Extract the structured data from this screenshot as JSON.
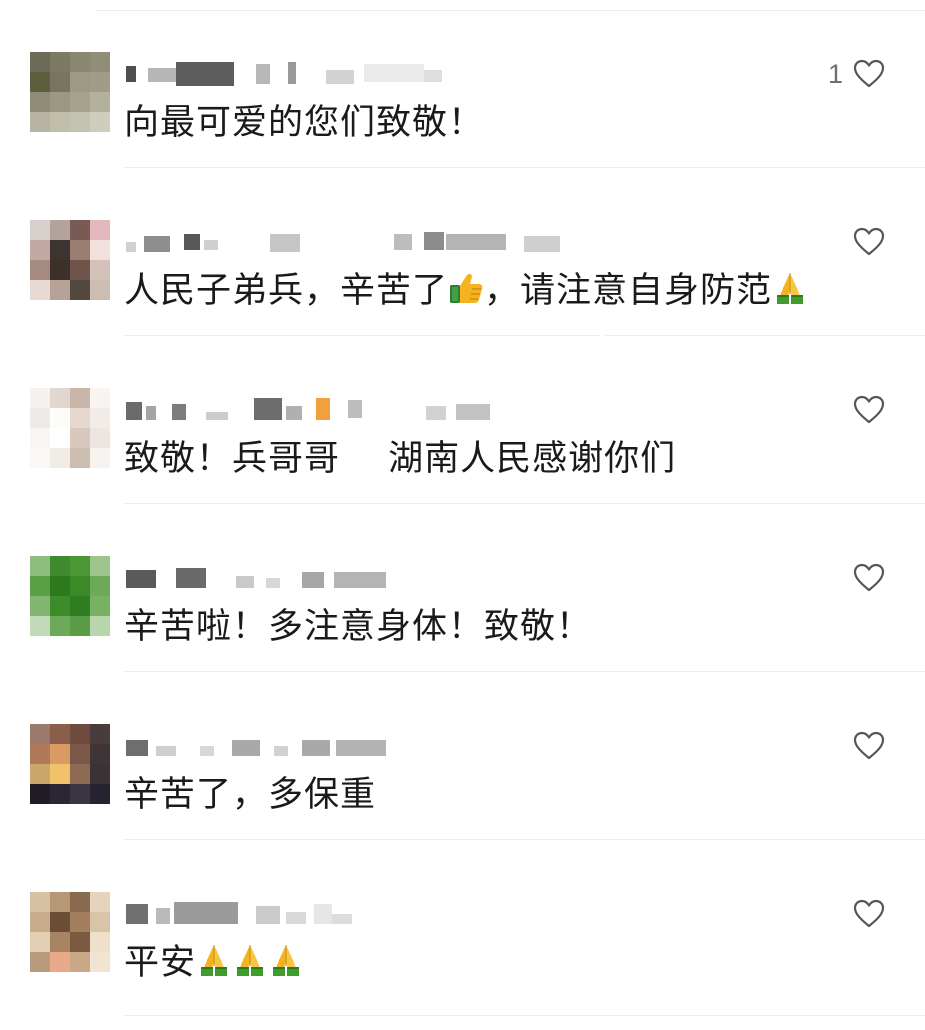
{
  "comments": [
    {
      "text_segments": [
        "向最可爱的您们致敬！"
      ],
      "likes": "1",
      "avatar_colors": [
        "#6d6a58",
        "#7c7a63",
        "#8a8770",
        "#908d78",
        "#5c5f3c",
        "#77755f",
        "#9c9985",
        "#a09c88",
        "#8f8c77",
        "#9b9882",
        "#a5a28d",
        "#b3b09d",
        "#b7b4a3",
        "#c1bea9",
        "#c4c2b0",
        "#cfcdbd"
      ]
    },
    {
      "text_segments": [
        "人民子弟兵，辛苦了",
        "，请注意自身防范",
        ""
      ],
      "emojis": [
        "thumbs-up",
        "folded-hands"
      ],
      "likes": "",
      "avatar_colors": [
        "#d8d0cd",
        "#b4a29d",
        "#7a5a55",
        "#e3b9bd",
        "#c2a9a3",
        "#3d3431",
        "#9b7d72",
        "#f1e0dc",
        "#a58a80",
        "#3c302a",
        "#6e5449",
        "#d4c2ba",
        "#e6dad3",
        "#b5a196",
        "#54473d",
        "#cdbcb2"
      ]
    },
    {
      "text_segments": [
        "致敬！兵哥哥　 湖南人民感谢你们"
      ],
      "likes": "",
      "avatar_colors": [
        "#f4f1ef",
        "#e0d7cf",
        "#c9b6a8",
        "#f7f4f1",
        "#eeeae6",
        "#fdfcfb",
        "#e6d8cf",
        "#f2ece7",
        "#f8f5f3",
        "#ffffff",
        "#d9c8bd",
        "#ece5e0",
        "#faf8f6",
        "#f1ebe6",
        "#cdbcb0",
        "#f6f2ee"
      ]
    },
    {
      "text_segments": [
        "辛苦啦！多注意身体！致敬！"
      ],
      "likes": "",
      "avatar_colors": [
        "#8fbd7e",
        "#3f8a2f",
        "#4c9635",
        "#9cc48b",
        "#58a043",
        "#2c7a1d",
        "#3b8a27",
        "#6daa58",
        "#83b572",
        "#3e8b2a",
        "#2f7d20",
        "#78b064",
        "#c3dab8",
        "#6ea95a",
        "#5b9d46",
        "#b9d5ac"
      ]
    },
    {
      "text_segments": [
        "辛苦了，多保重"
      ],
      "likes": "",
      "avatar_colors": [
        "#9a7a6a",
        "#8b5e4c",
        "#6e4a3f",
        "#4a3c3c",
        "#b07a5a",
        "#d99a63",
        "#7c5848",
        "#3f3537",
        "#caa56c",
        "#f0c36a",
        "#8e6a52",
        "#3a3236",
        "#1f1c25",
        "#2c2633",
        "#3b3542",
        "#262230"
      ]
    },
    {
      "text_segments": [
        "平安",
        "",
        "",
        ""
      ],
      "emojis": [
        "folded-hands",
        "folded-hands",
        "folded-hands"
      ],
      "likes": "",
      "avatar_colors": [
        "#d6c2a3",
        "#b69876",
        "#8a6a4f",
        "#e5d3bb",
        "#c8ac8c",
        "#6b4d37",
        "#a47f5e",
        "#d9c4a8",
        "#e4cfb5",
        "#a88462",
        "#7b5a42",
        "#efdfcb",
        "#b79b7c",
        "#e7a98a",
        "#caa887",
        "#f2e4d3"
      ]
    }
  ],
  "colors": {
    "text": "#1a1a1a",
    "like_count": "#6f6f6f",
    "heart_stroke": "#555555",
    "divider": "#ededed"
  }
}
